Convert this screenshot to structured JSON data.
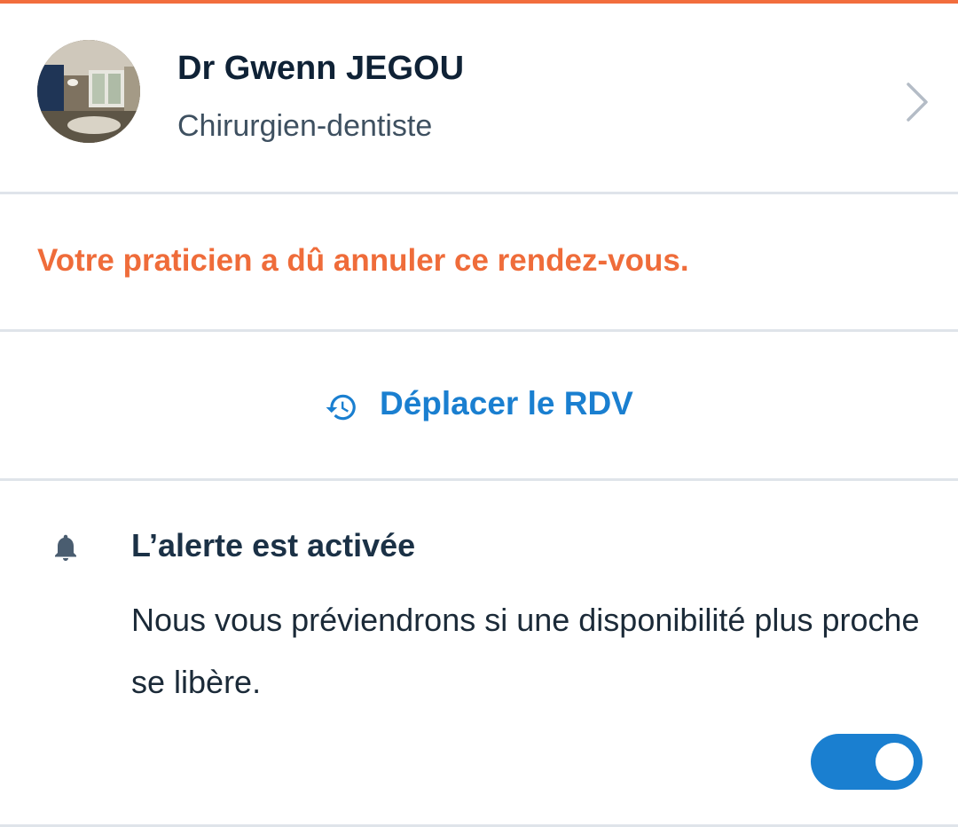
{
  "practitioner": {
    "name": "Dr Gwenn JEGOU",
    "speciality": "Chirurgien-dentiste",
    "avatar_icon": "practitioner-photo",
    "chevron_icon": "chevron-right-icon"
  },
  "notice": {
    "text": "Votre praticien a dû annuler ce rendez-vous.",
    "color": "#ef6c3a"
  },
  "move_appointment": {
    "label": "Déplacer le RDV",
    "icon": "history-icon",
    "color": "#1a7fd0"
  },
  "alert": {
    "icon": "bell-icon",
    "title": "L’alerte est activée",
    "description": "Nous vous préviendrons si une disponibilité plus proche se libère.",
    "toggle_on": true
  },
  "colors": {
    "accent": "#f26d3d",
    "primary": "#1a7fd0",
    "divider": "#dfe4ea"
  }
}
